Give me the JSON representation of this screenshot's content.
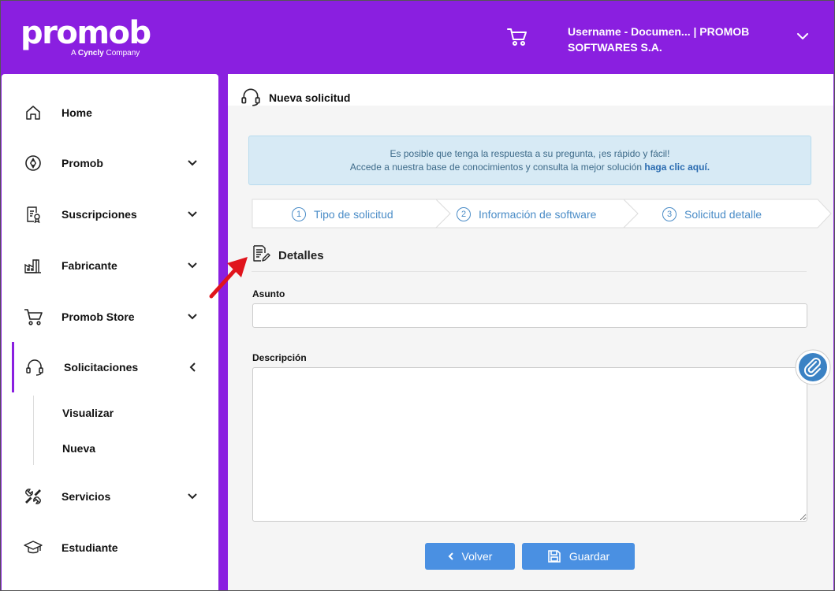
{
  "header": {
    "logo_main": "promob",
    "logo_sub_prefix": "A",
    "logo_sub_brand": "Cyncly",
    "logo_sub_suffix": "Company",
    "user_line1": "Username - Documen... | PROMOB",
    "user_line2": "SOFTWARES S.A."
  },
  "sidebar": {
    "items": [
      {
        "label": "Home",
        "icon": "home-icon"
      },
      {
        "label": "Promob",
        "icon": "promob-icon"
      },
      {
        "label": "Suscripciones",
        "icon": "subscription-icon"
      },
      {
        "label": "Fabricante",
        "icon": "factory-icon"
      },
      {
        "label": "Promob Store",
        "icon": "cart-icon"
      },
      {
        "label": "Solicitaciones",
        "icon": "headset-icon"
      },
      {
        "label": "Servicios",
        "icon": "tools-icon"
      },
      {
        "label": "Estudiante",
        "icon": "graduation-cap-icon"
      }
    ],
    "subitems": [
      {
        "label": "Visualizar"
      },
      {
        "label": "Nueva"
      }
    ]
  },
  "main": {
    "title": "Nueva solicitud",
    "info_line1": "Es posible que tenga la respuesta a su pregunta, ¡es rápido y fácil!",
    "info_line2_prefix": "Accede a nuestra base de conocimientos y consulta la mejor solución",
    "info_link": "haga clic aquí.",
    "steps": [
      {
        "num": "1",
        "label": "Tipo de solicitud"
      },
      {
        "num": "2",
        "label": "Información de software"
      },
      {
        "num": "3",
        "label": "Solicitud detalle"
      }
    ],
    "section_title": "Detalles",
    "asunto_label": "Asunto",
    "asunto_value": "",
    "descripcion_label": "Descripción",
    "descripcion_value": "",
    "btn_volver": "Volver",
    "btn_guardar": "Guardar"
  },
  "colors": {
    "brand_purple": "#8a1fe0",
    "button_blue": "#4a90e2",
    "info_bg": "#d7eaf5",
    "step_blue": "#4a8cc7",
    "arrow_red": "#e0141c"
  }
}
